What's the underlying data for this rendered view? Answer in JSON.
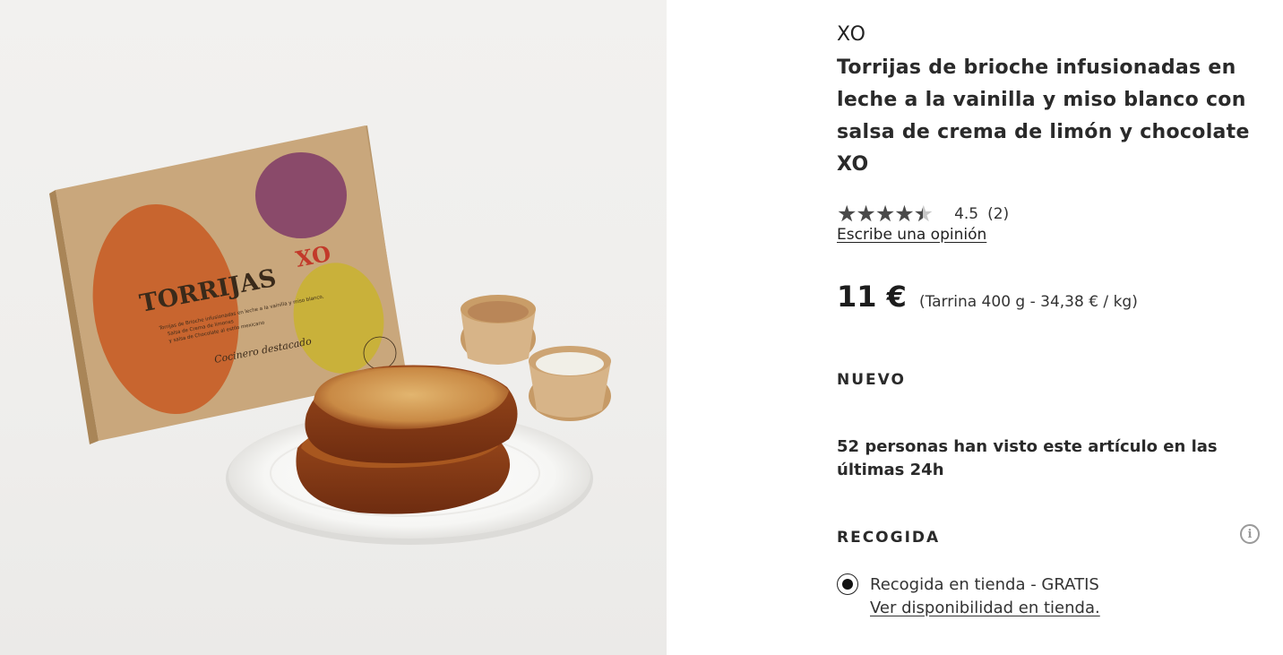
{
  "product_image": {
    "alt": "Torrijas XO",
    "package_brand": "TORRIJAS",
    "package_logo": "XO",
    "package_subtitle": "Torrijas de Brioche infusionadas en leche a la vainilla y miso blanco, Salsa de Crema de limones y salsa de Chocolate al estilo mexicano",
    "package_signature": "Cocinero destacado",
    "colors": {
      "kraft": "#c9a77c",
      "orange_circle": "#c8652f",
      "purple_circle": "#8a4a6a",
      "yellow_circle": "#c9b13a",
      "toast": "#9a4a1e"
    }
  },
  "product": {
    "brand": "XO",
    "title": "Torrijas de brioche infusionadas en leche a la vainilla y miso blanco con salsa de crema de limón y chocolate XO",
    "rating": {
      "stars": "★★★★★",
      "value": "4.5",
      "fill_fraction": 0.9,
      "count": "(2)",
      "review_link": "Escribe una opinión"
    },
    "price": {
      "amount": "11 €",
      "unit": "(Tarrina 400 g - 34,38 € / kg)"
    },
    "badge": "NUEVO",
    "views_notice": "52 personas han visto este artículo en las últimas 24h",
    "pickup": {
      "label": "RECOGIDA",
      "info_icon": "i",
      "option_label": "Recogida en tienda - GRATIS",
      "availability_link": "Ver disponibilidad en tienda."
    }
  }
}
